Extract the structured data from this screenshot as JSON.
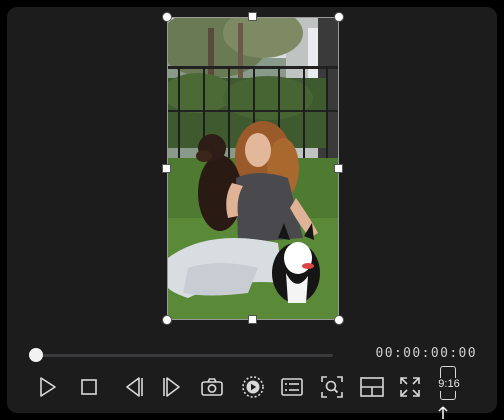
{
  "player": {
    "timecode": "00:00:00:00",
    "aspect_ratio": "9:16",
    "playhead_fraction": 0.0,
    "colors": {
      "panel": "#1c1c1c",
      "icon": "#d8d8d8",
      "track": "#3a3a3d",
      "scrubber": "#f2f2f2"
    }
  },
  "toolbar": {
    "buttons": [
      {
        "name": "play-icon"
      },
      {
        "name": "stop-icon"
      },
      {
        "name": "previous-frame-icon"
      },
      {
        "name": "next-frame-icon"
      },
      {
        "name": "snapshot-camera-icon"
      },
      {
        "name": "playback-speed-icon"
      },
      {
        "name": "subtitles-list-icon"
      },
      {
        "name": "zoom-search-icon"
      },
      {
        "name": "split-layout-icon"
      },
      {
        "name": "fullscreen-expand-icon"
      }
    ]
  }
}
